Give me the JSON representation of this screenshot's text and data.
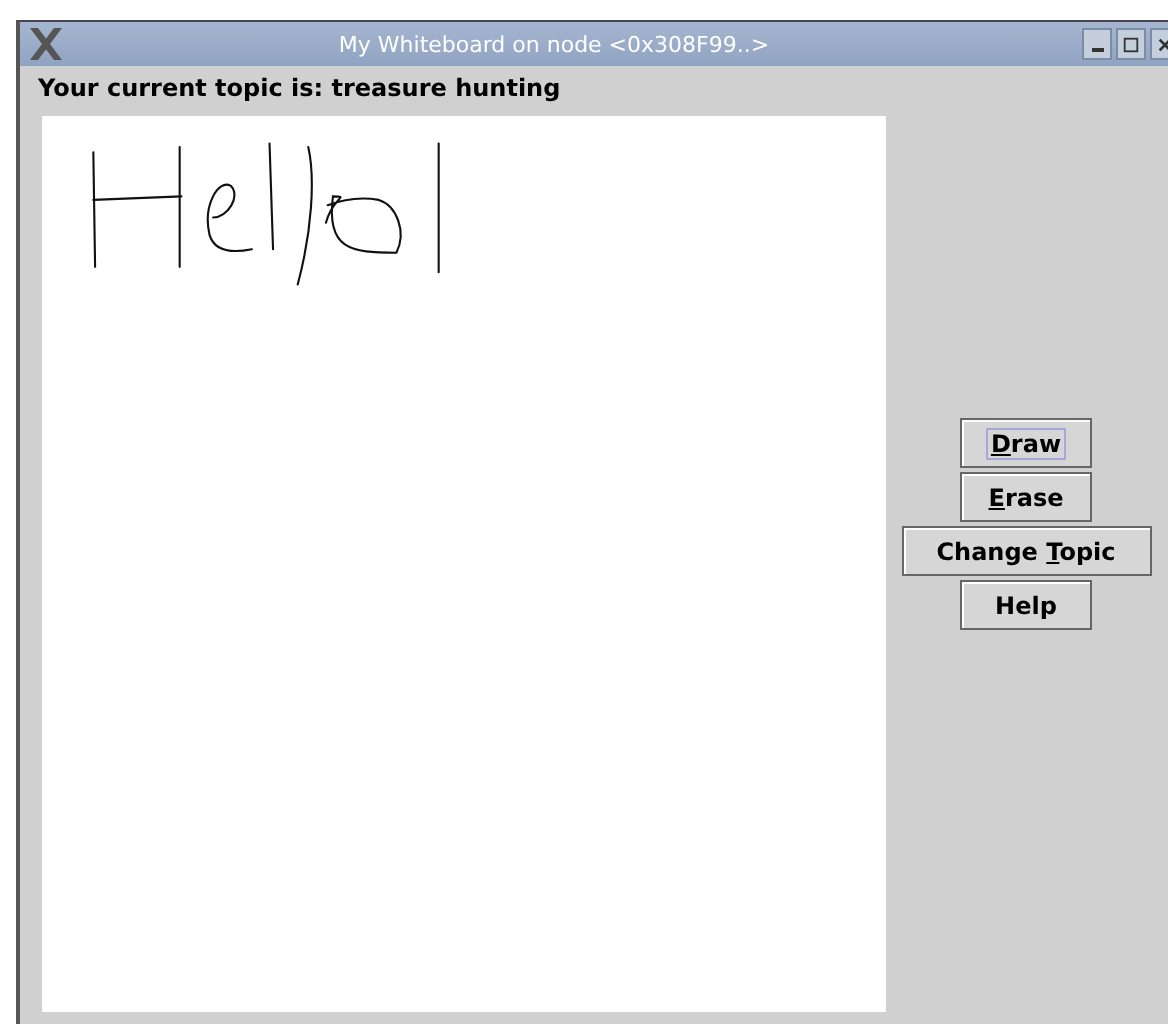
{
  "window": {
    "title": "My Whiteboard on node <0x308F99..>"
  },
  "topic_label": "Your current topic is: treasure hunting",
  "canvas": {
    "kind": "freehand"
  },
  "buttons": [
    {
      "focused": true,
      "words": [
        {
          "text": "Draw",
          "initial_underlined": true
        }
      ]
    },
    {
      "focused": false,
      "words": [
        {
          "text": "Erase",
          "initial_underlined": true
        }
      ]
    },
    {
      "focused": false,
      "words": [
        {
          "text": "Change",
          "initial_underlined": false
        },
        {
          "text": "Topic",
          "initial_underlined": true
        }
      ]
    },
    {
      "focused": false,
      "words": [
        {
          "text": "Help",
          "initial_underlined": false
        }
      ]
    }
  ]
}
